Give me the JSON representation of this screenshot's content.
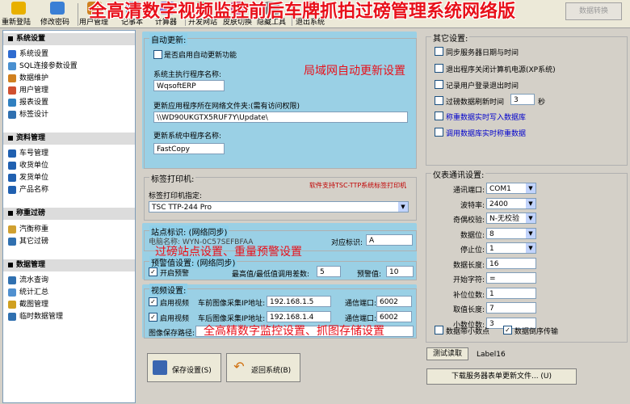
{
  "toolbar": {
    "buttons": [
      {
        "label": "重新登陆",
        "icon": "key-icon",
        "color": "#e8b000"
      },
      {
        "label": "修改密码",
        "icon": "key-lock-icon",
        "color": "#3a7fd5"
      },
      {
        "label": "用户管理",
        "icon": "user-icon",
        "color": "#d08020"
      },
      {
        "label": "记事本",
        "icon": "notepad-icon",
        "color": "#5b8fd0"
      },
      {
        "label": "计算器",
        "icon": "calculator-icon",
        "color": "#9070d0"
      },
      {
        "label": "开发网站",
        "icon": "web-icon",
        "color": "#4a9a40"
      },
      {
        "label": "皮肤切换",
        "icon": "skin-icon",
        "color": "#d05090"
      },
      {
        "label": "隐藏工具",
        "icon": "hide-icon",
        "color": "#808080"
      },
      {
        "label": "退出系统",
        "icon": "exit-icon",
        "color": "#d03030"
      }
    ],
    "banner": "全高清数字视频监控前后车牌抓拍过磅管理系统网络版",
    "switch_label": "数据转换"
  },
  "sidebar": {
    "sections": [
      {
        "title": "系统设置",
        "items": [
          {
            "label": "系统设置",
            "color": "#2e6bd0"
          },
          {
            "label": "SQL连接参数设置",
            "color": "#4a90d0"
          },
          {
            "label": "数据维护",
            "color": "#d08020"
          },
          {
            "label": "用户管理",
            "color": "#d05030"
          },
          {
            "label": "报表设置",
            "color": "#3080c0"
          },
          {
            "label": "标签设计",
            "color": "#3070b0"
          }
        ]
      },
      {
        "title": "资料管理",
        "items": [
          {
            "label": "车号管理",
            "color": "#2060b0"
          },
          {
            "label": "收货单位",
            "color": "#2060b0"
          },
          {
            "label": "发货单位",
            "color": "#2060b0"
          },
          {
            "label": "产品名称",
            "color": "#2060b0"
          }
        ]
      },
      {
        "title": "称重过磅",
        "items": [
          {
            "label": "汽衡称重",
            "color": "#d0a030"
          },
          {
            "label": "其它过磅",
            "color": "#3070b0"
          }
        ]
      },
      {
        "title": "数据管理",
        "items": [
          {
            "label": "流水查询",
            "color": "#3070b0"
          },
          {
            "label": "统计汇总",
            "color": "#5090d0"
          },
          {
            "label": "截图管理",
            "color": "#d0a020"
          },
          {
            "label": "临时数据管理",
            "color": "#3070b0"
          }
        ]
      }
    ]
  },
  "auto_update": {
    "title": "自动更新:",
    "enable_label": "是否启用自动更新功能",
    "exe_label": "系统主执行程序名称:",
    "exe_value": "WqsoftERP",
    "folder_label": "更新应用程序所在网络文件夹:(需有访问权限)",
    "folder_value": "\\\\WD90UKGTX5RUF7Y\\Update\\",
    "copy_label": "更新系统中程序名称:",
    "copy_value": "FastCopy",
    "annotation": "局域网自动更新设置"
  },
  "label_printer": {
    "title": "标签打印机:",
    "note": "软件支持TSC-TTP系统标签打印机",
    "printer_label": "标签打印机指定:",
    "printer_value": "TSC TTP-244 Pro"
  },
  "station": {
    "title": "站点标识: (网络同步)",
    "pc_label": "电脑名称: WYN-0C57SEFBFAA",
    "id_label": "对应标识:",
    "id_value": "A",
    "annotation": "过磅站点设置、重量预警设置"
  },
  "warning": {
    "title": "预警值设置: (网络同步)",
    "enable_label": "开启预警",
    "diff_label": "最高值/最低值调用差数:",
    "diff_value": "5",
    "warn_label": "预警值:",
    "warn_value": "10"
  },
  "video": {
    "title": "视频设置:",
    "rows": [
      {
        "enable": "启用视频",
        "ip_label": "车前图像采集IP地址:",
        "ip": "192.168.1.5",
        "port_label": "通信端口:",
        "port": "6002"
      },
      {
        "enable": "启用视频",
        "ip_label": "车后图像采集IP地址:",
        "ip": "192.168.1.4",
        "port_label": "通信端口:",
        "port": "6002"
      }
    ],
    "path_label": "图像保存路径:",
    "annotation": "全高精数字监控设置、抓图存储设置"
  },
  "actions": {
    "save": "保存设置(S)",
    "back": "返回系统(B)"
  },
  "other": {
    "title": "其它设置:",
    "sync_time": "同步服务器日期与时间",
    "shutdown": "退出程序关闭计算机电源(XP系统)",
    "log_login": "记录用户登录退出时间",
    "refresh_label": "过磅数据刷新时间",
    "refresh_value": "3",
    "refresh_unit": "秒",
    "write_db": "称重数据实时写入数据库",
    "read_db": "调用数据库实时称重数据"
  },
  "instrument": {
    "title": "仪表通讯设置:",
    "fields": [
      {
        "label": "通讯端口:",
        "value": "COM1",
        "type": "select"
      },
      {
        "label": "波特率:",
        "value": "2400",
        "type": "select"
      },
      {
        "label": "奇偶校验:",
        "value": "N-无校验",
        "type": "select"
      },
      {
        "label": "数据位:",
        "value": "8",
        "type": "select"
      },
      {
        "label": "停止位:",
        "value": "1",
        "type": "select"
      },
      {
        "label": "数据长度:",
        "value": "16",
        "type": "input"
      },
      {
        "label": "开始字符:",
        "value": "=",
        "type": "input"
      },
      {
        "label": "补位位数:",
        "value": "1",
        "type": "input"
      },
      {
        "label": "取值长度:",
        "value": "7",
        "type": "input"
      },
      {
        "label": "小数位数:",
        "value": "3",
        "type": "input"
      }
    ],
    "decimal_label": "数据带小数点",
    "reverse_label": "数据倒序传输"
  },
  "test": {
    "button": "测试读取",
    "label": "Label16"
  },
  "download_button": "下载服务器表单更新文件... (U)"
}
